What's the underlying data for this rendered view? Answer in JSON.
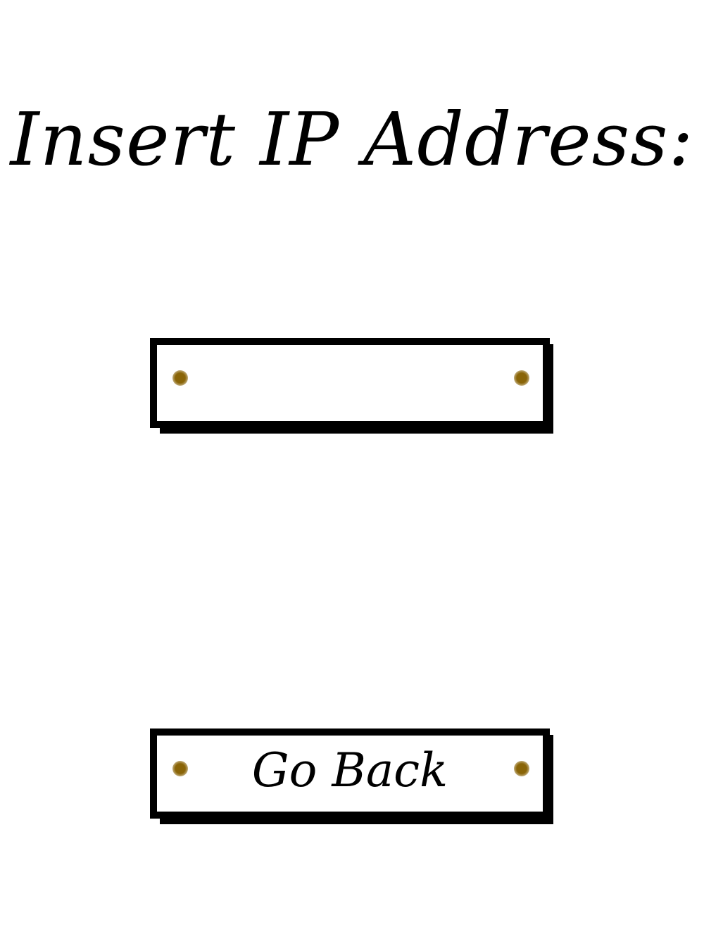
{
  "screen": {
    "title": "Insert IP Address:"
  },
  "ip_field": {
    "value": "",
    "placeholder": ""
  },
  "back_button": {
    "label": "Go Back"
  },
  "colors": {
    "background": "#ffffff",
    "ink": "#000000",
    "rivet": "#8a6508"
  },
  "icons": {
    "rivet": "brass-rivet-dot"
  }
}
